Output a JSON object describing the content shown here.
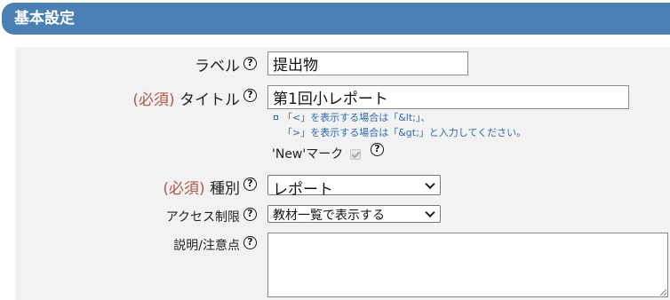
{
  "section": {
    "title": "基本設定"
  },
  "required_marker": "(必須)",
  "help_glyph": "?",
  "fields": {
    "label": {
      "label": "ラベル",
      "value": "提出物"
    },
    "title": {
      "label": "タイトル",
      "value": "第1回小レポート",
      "note_line1": "「<」を表示する場合は「&lt;」、",
      "note_line2": "「>」を表示する場合は「&gt;」と入力してください。"
    },
    "new_mark": {
      "label": "'New'マーク",
      "checked": true,
      "disabled": true
    },
    "type": {
      "label": "種別",
      "selected": "レポート"
    },
    "access": {
      "label": "アクセス制限",
      "selected": "教材一覧で表示する"
    },
    "description": {
      "label": "説明/注意点",
      "value": ""
    }
  },
  "colors": {
    "header_bg": "#4a80b4",
    "panel_bg": "#f2f2f2",
    "required": "#b05a45",
    "note": "#2a6bb0"
  }
}
